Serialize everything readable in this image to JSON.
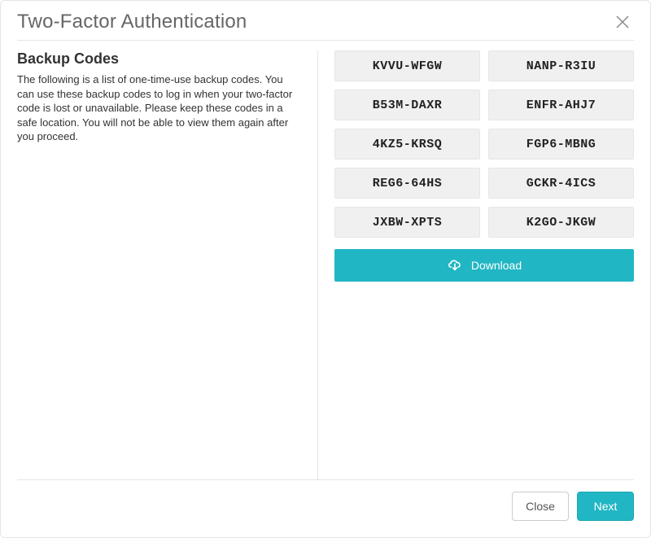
{
  "modal": {
    "title": "Two-Factor Authentication",
    "section_title": "Backup Codes",
    "description": "The following is a list of one-time-use backup codes. You can use these backup codes to log in when your two-factor code is lost or unavailable. Please keep these codes in a safe location. You will not be able to view them again after you proceed.",
    "download_label": "Download",
    "close_label": "Close",
    "next_label": "Next"
  },
  "backup_codes": [
    "KVVU-WFGW",
    "NANP-R3IU",
    "B53M-DAXR",
    "ENFR-AHJ7",
    "4KZ5-KRSQ",
    "FGP6-MBNG",
    "REG6-64HS",
    "GCKR-4ICS",
    "JXBW-XPTS",
    "K2GO-JKGW"
  ],
  "colors": {
    "accent": "#21b6c3"
  }
}
